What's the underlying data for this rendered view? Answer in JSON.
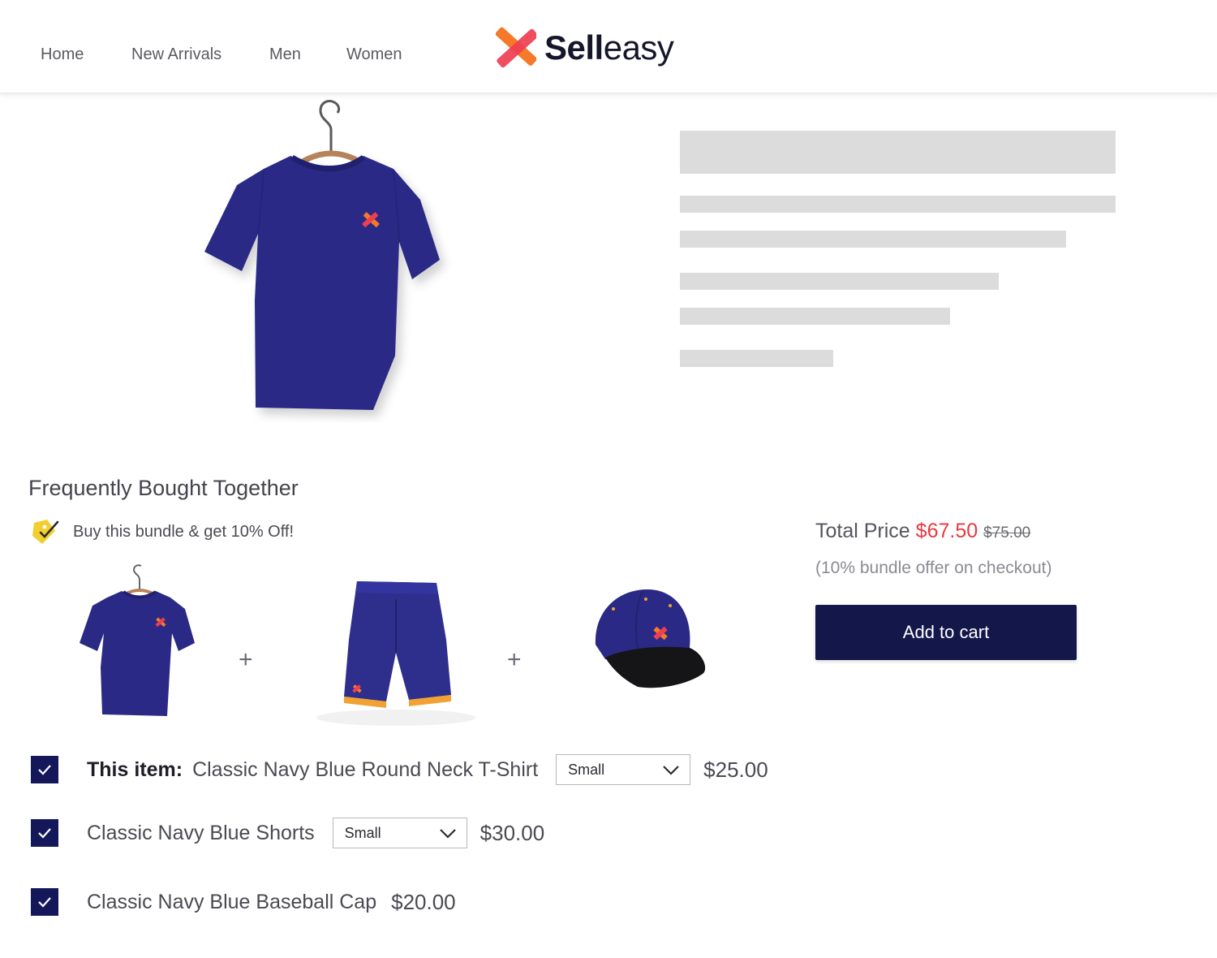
{
  "nav": {
    "links": [
      "Home",
      "New Arrivals",
      "Men",
      "Women"
    ]
  },
  "logo": {
    "bold": "Sell",
    "light": "easy",
    "icon": "x-logo-icon"
  },
  "bundle": {
    "title": "Frequently Bought Together",
    "offer_text": "Buy this bundle & get 10% Off!",
    "offer_icon": "tag-icon",
    "items": [
      {
        "prefix": "This item:",
        "name": "Classic Navy Blue Round Neck T-Shirt",
        "size": "Small",
        "price": "$25.00",
        "checked": true
      },
      {
        "prefix": "",
        "name": "Classic Navy Blue Shorts",
        "size": "Small",
        "price": "$30.00",
        "checked": true
      },
      {
        "prefix": "",
        "name": "Classic Navy Blue Baseball Cap",
        "size": "",
        "price": "$20.00",
        "checked": true
      }
    ],
    "plus": "+"
  },
  "summary": {
    "total_label": "Total Price",
    "total_new": "$67.50",
    "total_old": "$75.00",
    "note": "(10% bundle offer on checkout)",
    "add_to_cart": "Add to cart"
  },
  "colors": {
    "navy": "#14174a",
    "product_navy": "#2a2a86",
    "accent_red": "#e8393f",
    "accent_orange": "#f28a2e",
    "skeleton": "#dcdcdc"
  }
}
